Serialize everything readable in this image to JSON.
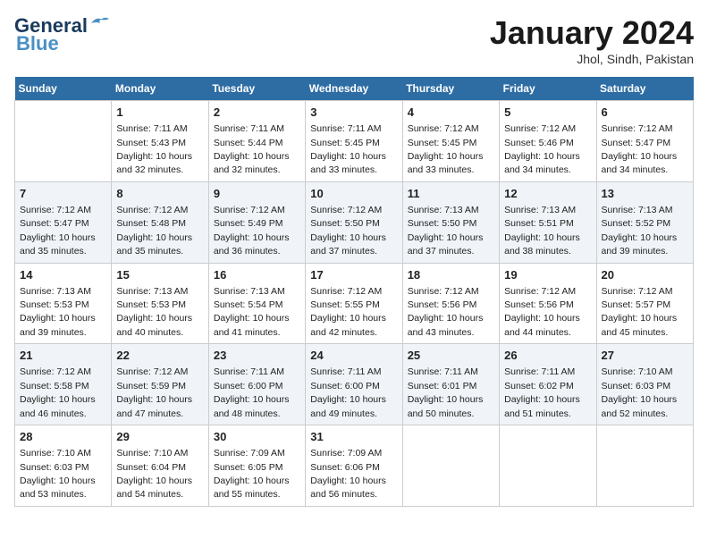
{
  "header": {
    "logo_line1": "General",
    "logo_line2": "Blue",
    "month": "January 2024",
    "location": "Jhol, Sindh, Pakistan"
  },
  "weekdays": [
    "Sunday",
    "Monday",
    "Tuesday",
    "Wednesday",
    "Thursday",
    "Friday",
    "Saturday"
  ],
  "weeks": [
    [
      {
        "day": null
      },
      {
        "day": 1,
        "sunrise": "7:11 AM",
        "sunset": "5:43 PM",
        "daylight": "10 hours and 32 minutes."
      },
      {
        "day": 2,
        "sunrise": "7:11 AM",
        "sunset": "5:44 PM",
        "daylight": "10 hours and 32 minutes."
      },
      {
        "day": 3,
        "sunrise": "7:11 AM",
        "sunset": "5:45 PM",
        "daylight": "10 hours and 33 minutes."
      },
      {
        "day": 4,
        "sunrise": "7:12 AM",
        "sunset": "5:45 PM",
        "daylight": "10 hours and 33 minutes."
      },
      {
        "day": 5,
        "sunrise": "7:12 AM",
        "sunset": "5:46 PM",
        "daylight": "10 hours and 34 minutes."
      },
      {
        "day": 6,
        "sunrise": "7:12 AM",
        "sunset": "5:47 PM",
        "daylight": "10 hours and 34 minutes."
      }
    ],
    [
      {
        "day": 7,
        "sunrise": "7:12 AM",
        "sunset": "5:47 PM",
        "daylight": "10 hours and 35 minutes."
      },
      {
        "day": 8,
        "sunrise": "7:12 AM",
        "sunset": "5:48 PM",
        "daylight": "10 hours and 35 minutes."
      },
      {
        "day": 9,
        "sunrise": "7:12 AM",
        "sunset": "5:49 PM",
        "daylight": "10 hours and 36 minutes."
      },
      {
        "day": 10,
        "sunrise": "7:12 AM",
        "sunset": "5:50 PM",
        "daylight": "10 hours and 37 minutes."
      },
      {
        "day": 11,
        "sunrise": "7:13 AM",
        "sunset": "5:50 PM",
        "daylight": "10 hours and 37 minutes."
      },
      {
        "day": 12,
        "sunrise": "7:13 AM",
        "sunset": "5:51 PM",
        "daylight": "10 hours and 38 minutes."
      },
      {
        "day": 13,
        "sunrise": "7:13 AM",
        "sunset": "5:52 PM",
        "daylight": "10 hours and 39 minutes."
      }
    ],
    [
      {
        "day": 14,
        "sunrise": "7:13 AM",
        "sunset": "5:53 PM",
        "daylight": "10 hours and 39 minutes."
      },
      {
        "day": 15,
        "sunrise": "7:13 AM",
        "sunset": "5:53 PM",
        "daylight": "10 hours and 40 minutes."
      },
      {
        "day": 16,
        "sunrise": "7:13 AM",
        "sunset": "5:54 PM",
        "daylight": "10 hours and 41 minutes."
      },
      {
        "day": 17,
        "sunrise": "7:12 AM",
        "sunset": "5:55 PM",
        "daylight": "10 hours and 42 minutes."
      },
      {
        "day": 18,
        "sunrise": "7:12 AM",
        "sunset": "5:56 PM",
        "daylight": "10 hours and 43 minutes."
      },
      {
        "day": 19,
        "sunrise": "7:12 AM",
        "sunset": "5:56 PM",
        "daylight": "10 hours and 44 minutes."
      },
      {
        "day": 20,
        "sunrise": "7:12 AM",
        "sunset": "5:57 PM",
        "daylight": "10 hours and 45 minutes."
      }
    ],
    [
      {
        "day": 21,
        "sunrise": "7:12 AM",
        "sunset": "5:58 PM",
        "daylight": "10 hours and 46 minutes."
      },
      {
        "day": 22,
        "sunrise": "7:12 AM",
        "sunset": "5:59 PM",
        "daylight": "10 hours and 47 minutes."
      },
      {
        "day": 23,
        "sunrise": "7:11 AM",
        "sunset": "6:00 PM",
        "daylight": "10 hours and 48 minutes."
      },
      {
        "day": 24,
        "sunrise": "7:11 AM",
        "sunset": "6:00 PM",
        "daylight": "10 hours and 49 minutes."
      },
      {
        "day": 25,
        "sunrise": "7:11 AM",
        "sunset": "6:01 PM",
        "daylight": "10 hours and 50 minutes."
      },
      {
        "day": 26,
        "sunrise": "7:11 AM",
        "sunset": "6:02 PM",
        "daylight": "10 hours and 51 minutes."
      },
      {
        "day": 27,
        "sunrise": "7:10 AM",
        "sunset": "6:03 PM",
        "daylight": "10 hours and 52 minutes."
      }
    ],
    [
      {
        "day": 28,
        "sunrise": "7:10 AM",
        "sunset": "6:03 PM",
        "daylight": "10 hours and 53 minutes."
      },
      {
        "day": 29,
        "sunrise": "7:10 AM",
        "sunset": "6:04 PM",
        "daylight": "10 hours and 54 minutes."
      },
      {
        "day": 30,
        "sunrise": "7:09 AM",
        "sunset": "6:05 PM",
        "daylight": "10 hours and 55 minutes."
      },
      {
        "day": 31,
        "sunrise": "7:09 AM",
        "sunset": "6:06 PM",
        "daylight": "10 hours and 56 minutes."
      },
      {
        "day": null
      },
      {
        "day": null
      },
      {
        "day": null
      }
    ]
  ]
}
